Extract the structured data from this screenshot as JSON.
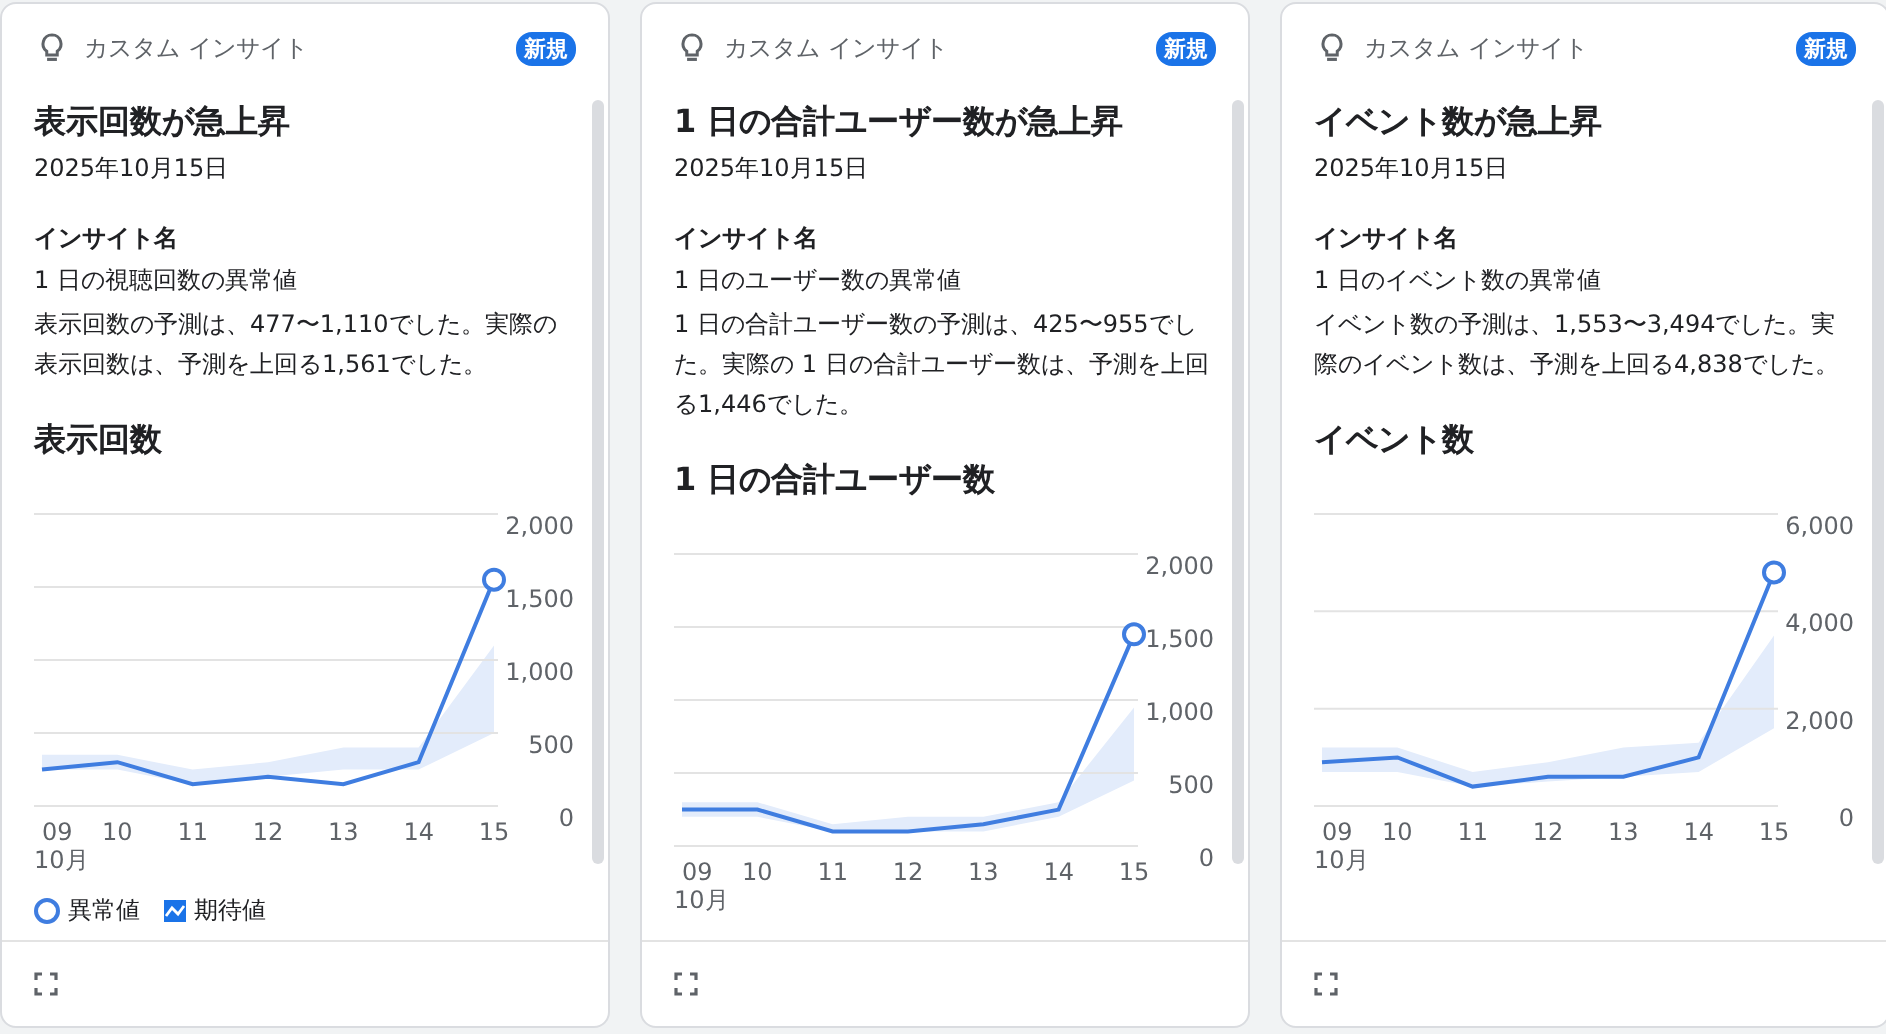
{
  "cards": [
    {
      "category": "カスタム インサイト",
      "badge": "新規",
      "title": "表示回数が急上昇",
      "date": "2025年10月15日",
      "name_label": "インサイト名",
      "name": "1 日の視聴回数の異常値",
      "description": "表示回数の予測は、477〜1,110でした。実際の表示回数は、予測を上回る1,561でした。",
      "chart_title": "表示回数",
      "chart_data": {
        "type": "line",
        "categories": [
          "09",
          "10",
          "11",
          "12",
          "13",
          "14",
          "15"
        ],
        "xlabel": "10月",
        "ylim": [
          0,
          2000
        ],
        "grid": true,
        "yticks": [
          {
            "value": 0,
            "label": "0"
          },
          {
            "value": 500,
            "label": "500"
          },
          {
            "value": 1000,
            "label": "1,000"
          },
          {
            "value": 1500,
            "label": "1,500"
          },
          {
            "value": 2000,
            "label": "2,000"
          }
        ],
        "series": [
          {
            "name": "異常値",
            "color": "#3f7de0",
            "values": [
              250,
              300,
              150,
              200,
              150,
              300,
              1550
            ]
          },
          {
            "name": "期待値",
            "color": "#e3ecfb",
            "type": "area",
            "values": [
              350,
              350,
              250,
              300,
              400,
              400,
              1100
            ]
          },
          {
            "color": "#ffffff",
            "type": "area",
            "values": [
              250,
              250,
              150,
              200,
              250,
              250,
              500
            ]
          }
        ]
      }
    },
    {
      "category": "カスタム インサイト",
      "badge": "新規",
      "title": "1 日の合計ユーザー数が急上昇",
      "date": "2025年10月15日",
      "name_label": "インサイト名",
      "name": "1 日のユーザー数の異常値",
      "description": "1 日の合計ユーザー数の予測は、425〜955でした。実際の 1 日の合計ユーザー数は、予測を上回る1,446でした。",
      "chart_title": "1 日の合計ユーザー数",
      "chart_data": {
        "type": "line",
        "categories": [
          "09",
          "10",
          "11",
          "12",
          "13",
          "14",
          "15"
        ],
        "xlabel": "10月",
        "ylim": [
          0,
          2000
        ],
        "grid": true,
        "yticks": [
          {
            "value": 0,
            "label": "0"
          },
          {
            "value": 500,
            "label": "500"
          },
          {
            "value": 1000,
            "label": "1,000"
          },
          {
            "value": 1500,
            "label": "1,500"
          },
          {
            "value": 2000,
            "label": "2,000"
          }
        ],
        "series": [
          {
            "color": "#3f7de0",
            "values": [
              250,
              250,
              100,
              100,
              150,
              250,
              1450
            ]
          },
          {
            "color": "#e3ecfb",
            "type": "area",
            "values": [
              300,
              300,
              150,
              200,
              200,
              300,
              950
            ]
          },
          {
            "color": "#ffffff",
            "type": "area",
            "values": [
              200,
              200,
              100,
              100,
              100,
              200,
              450
            ]
          }
        ]
      }
    },
    {
      "category": "カスタム インサイト",
      "badge": "新規",
      "title": "イベント数が急上昇",
      "date": "2025年10月15日",
      "name_label": "インサイト名",
      "name": "1 日のイベント数の異常値",
      "description": "イベント数の予測は、1,553〜3,494でした。実際のイベント数は、予測を上回る4,838でした。",
      "chart_title": "イベント数",
      "chart_data": {
        "type": "line",
        "categories": [
          "09",
          "10",
          "11",
          "12",
          "13",
          "14",
          "15"
        ],
        "xlabel": "10月",
        "ylim": [
          0,
          6000
        ],
        "grid": true,
        "yticks": [
          {
            "value": 0,
            "label": "0"
          },
          {
            "value": 2000,
            "label": "2,000"
          },
          {
            "value": 4000,
            "label": "4,000"
          },
          {
            "value": 6000,
            "label": "6,000"
          }
        ],
        "series": [
          {
            "color": "#3f7de0",
            "values": [
              900,
              1000,
              400,
              600,
              600,
              1000,
              4800
            ]
          },
          {
            "color": "#e3ecfb",
            "type": "area",
            "values": [
              1200,
              1200,
              700,
              900,
              1200,
              1300,
              3500
            ]
          },
          {
            "color": "#ffffff",
            "type": "area",
            "values": [
              700,
              700,
              400,
              500,
              600,
              700,
              1600
            ]
          }
        ]
      }
    }
  ]
}
